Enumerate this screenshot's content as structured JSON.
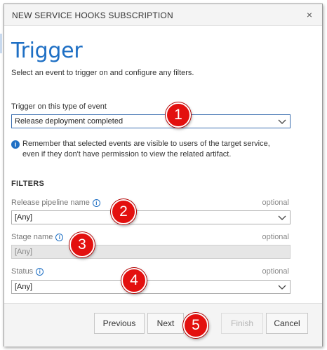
{
  "dialog": {
    "title": "NEW SERVICE HOOKS SUBSCRIPTION",
    "close_glyph": "×"
  },
  "page": {
    "heading": "Trigger",
    "subtext": "Select an event to trigger on and configure any filters."
  },
  "event_trigger": {
    "label": "Trigger on this type of event",
    "value": "Release deployment completed"
  },
  "notice": {
    "line1": "Remember that selected events are visible to users of the target service,",
    "line2": "even if they don't have permission to view the related artifact."
  },
  "filters": {
    "title": "FILTERS",
    "optional_text": "optional",
    "release_pipeline": {
      "label": "Release pipeline name",
      "value": "[Any]"
    },
    "stage": {
      "label": "Stage name",
      "value": "[Any]"
    },
    "status": {
      "label": "Status",
      "value": "[Any]"
    }
  },
  "buttons": {
    "previous": "Previous",
    "next": "Next",
    "finish": "Finish",
    "cancel": "Cancel"
  },
  "callouts": [
    "1",
    "2",
    "3",
    "4",
    "5"
  ],
  "colors": {
    "accent": "#1e6fc4",
    "callout": "#e3100f"
  }
}
